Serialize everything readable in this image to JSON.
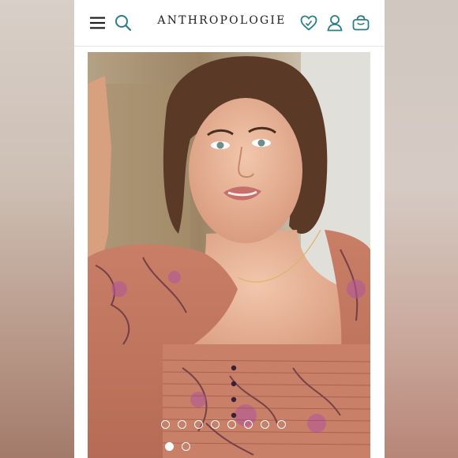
{
  "header": {
    "brand": "ANTHROPOLOGIE",
    "icons": [
      "menu-icon",
      "search-icon",
      "heart-icon",
      "user-icon",
      "bag-icon"
    ],
    "accent_color": "#2a7f84"
  },
  "carousel": {
    "image_count": 8,
    "active_index": 0,
    "secondary_count": 2,
    "secondary_active_index": 0
  }
}
